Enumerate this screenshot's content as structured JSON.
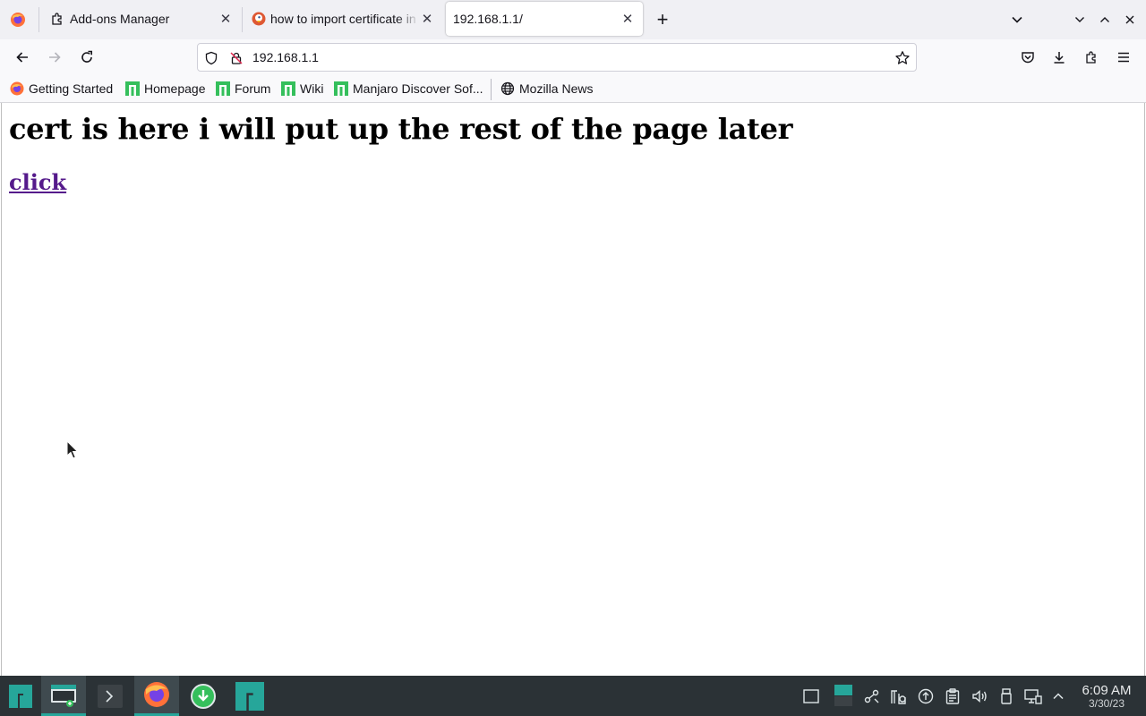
{
  "browser": {
    "tabs": [
      {
        "label": "Add-ons Manager",
        "icon": "puzzle-icon"
      },
      {
        "label": "how to import certificate in",
        "icon": "duckduckgo-icon"
      },
      {
        "label": "192.168.1.1/",
        "icon": "none",
        "active": true
      }
    ],
    "new_tab_label": "+",
    "url": "192.168.1.1",
    "bookmarks": [
      {
        "label": "Getting Started",
        "icon": "firefox-icon"
      },
      {
        "label": "Homepage",
        "icon": "manjaro-icon"
      },
      {
        "label": "Forum",
        "icon": "manjaro-icon"
      },
      {
        "label": "Wiki",
        "icon": "manjaro-icon"
      },
      {
        "label": "Manjaro Discover Sof...",
        "icon": "manjaro-icon"
      },
      {
        "label": "Mozilla News",
        "icon": "globe-icon"
      }
    ]
  },
  "page": {
    "heading": "cert is here i will put up the rest of the page later",
    "link_text": "click"
  },
  "taskbar": {
    "time": "6:09 AM",
    "date": "3/30/23"
  },
  "colors": {
    "accent": "#26a69a",
    "manjaro_green": "#35bf5c",
    "visited_link": "#551a8b",
    "taskbar_bg": "#2b3236"
  }
}
